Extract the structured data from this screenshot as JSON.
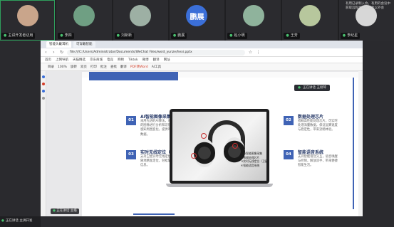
{
  "meeting": {
    "notice": "有用已录制入会，有用的会议中获取远程会以外入会以外会",
    "tiles": [
      {
        "name": "主讲开发者访用",
        "avatar_kind": "photo",
        "avatar_color": "#c9a58b",
        "active": true
      },
      {
        "name": "李四",
        "avatar_kind": "photo",
        "avatar_color": "#6f9f83",
        "active": false
      },
      {
        "name": "刘新新",
        "avatar_kind": "photo",
        "avatar_color": "#9db0a4",
        "active": false
      },
      {
        "name": "鹏展",
        "avatar_kind": "text",
        "avatar_text": "鹏展",
        "avatar_color": "#3b6fd8",
        "active": false
      },
      {
        "name": "赵小明",
        "avatar_kind": "photo",
        "avatar_color": "#8fb39c",
        "active": false
      },
      {
        "name": "王芳",
        "avatar_kind": "photo",
        "avatar_color": "#b7c79d",
        "active": false
      },
      {
        "name": "李纪星",
        "avatar_kind": "photo",
        "avatar_color": "#d7d7d7",
        "active": false
      }
    ],
    "self_name": "正在讲话 主讲开发",
    "floating_tag": "正在讲话 主播"
  },
  "browser": {
    "tabs": [
      "智能头戴耳机",
      "可穿戴智能"
    ],
    "url": "file:///C:/Users/Administrator/Documents/WeChat Files/wxid_yunze/hexi.pptx",
    "bookmarks": [
      "首页",
      "上网导航",
      "天猫精选",
      "京东商城",
      "电竞",
      "购物",
      "Tiktok",
      "微博",
      "翻译",
      "网址"
    ]
  },
  "pdf_toolbar": {
    "items": [
      "目录",
      "100%",
      "旋转",
      "双页",
      "打印",
      "批注",
      "查找",
      "翻译",
      "PDF转Word",
      "AI工具"
    ]
  },
  "slide": {
    "speaker": "正在讲话 王刚琴",
    "features": [
      {
        "num": "01",
        "title": "AI智能图像采集",
        "desc": "采用先进的AI算法，对环境中的图像进行分析和识别，精准感知周围变化，提供可靠视觉数据。"
      },
      {
        "num": "02",
        "title": "数据处理芯片",
        "desc": "搭载高性能处理芯片，可实时处理海量数据，保证运算速度与稳定性，带来流畅体验。"
      },
      {
        "num": "03",
        "title": "实时无线定位（卫星）",
        "desc": "支持卫星实时无线定位，随时随地精准定位，轻松掌握位置信息。"
      },
      {
        "num": "04",
        "title": "智能语音系统",
        "desc": "支持智能语音交互，语音唤醒与控制，解放双手，带来便捷智能生活。"
      }
    ],
    "product_labels": [
      "①AI智能图像采集",
      "②数据处理芯片",
      "③实时无线定位（卫星）",
      "④智能语音系统"
    ]
  }
}
